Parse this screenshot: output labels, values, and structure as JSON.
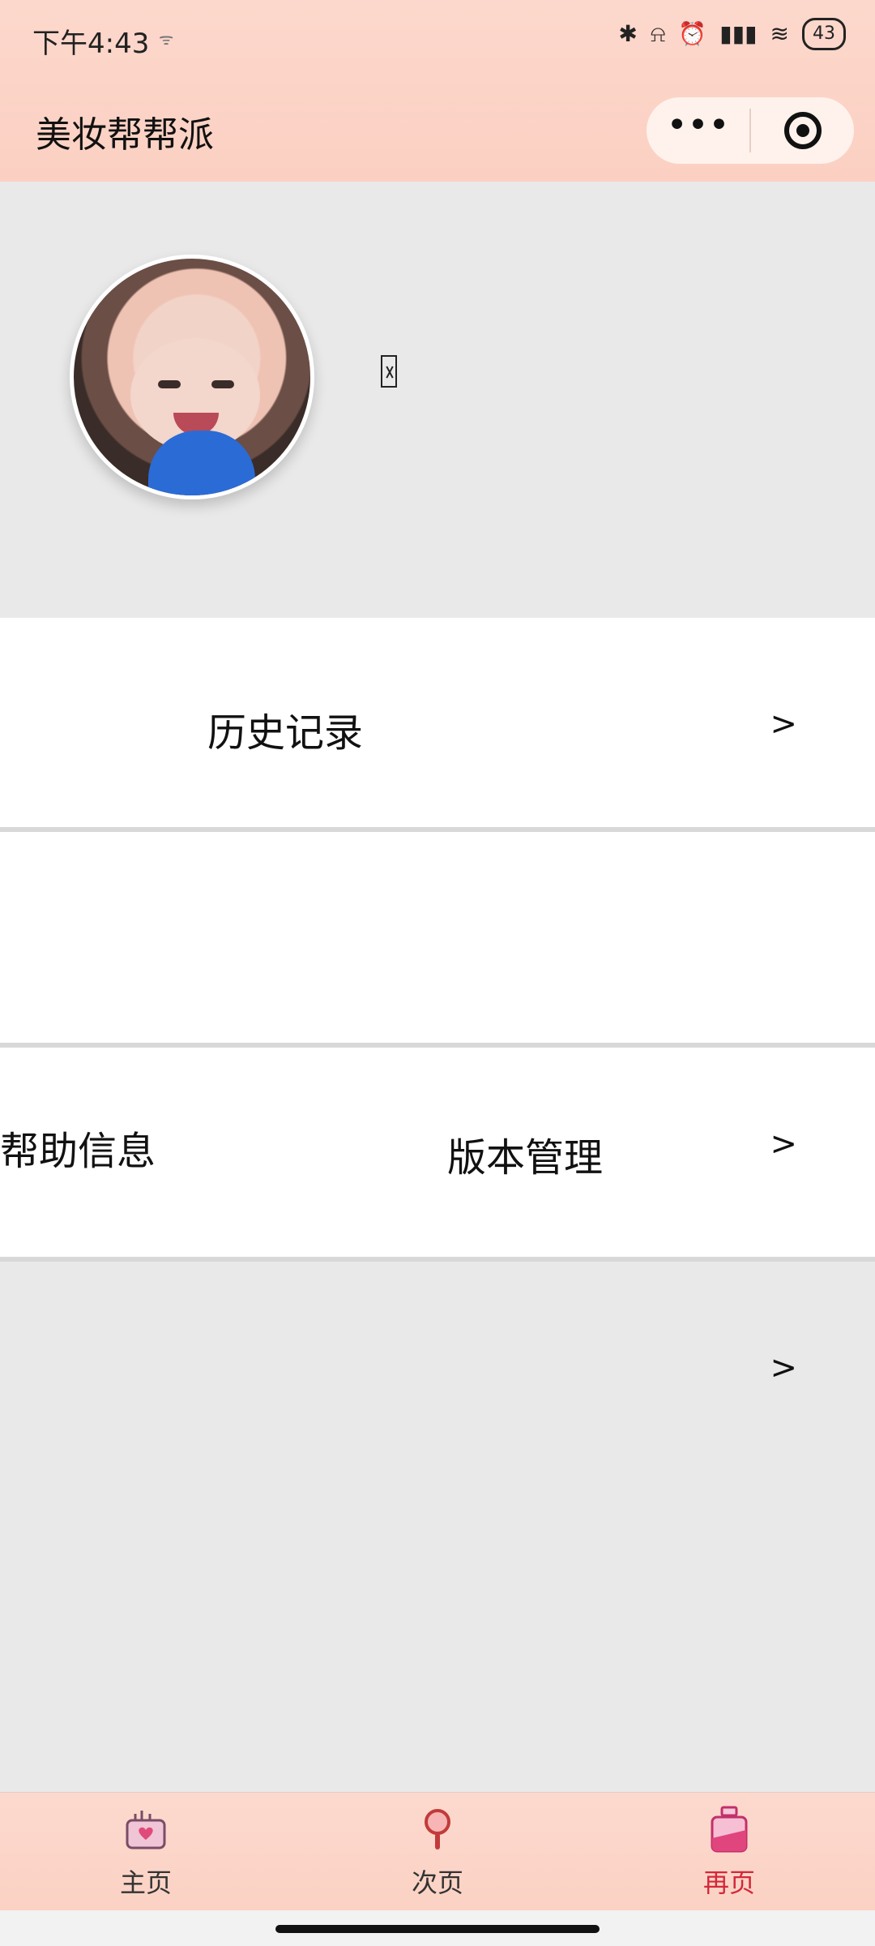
{
  "status_bar": {
    "time": "下午4:43",
    "small_indicator": "ᯤ",
    "battery": "43"
  },
  "nav": {
    "title": "美妆帮帮派",
    "more_label": "•••"
  },
  "profile": {
    "placeholder_glyph": ""
  },
  "rows": {
    "history_label": "历史记录",
    "help_label": "帮助信息",
    "version_label": "版本管理",
    "arrow": ">"
  },
  "tabbar": {
    "items": [
      {
        "label": "主页"
      },
      {
        "label": "次页"
      },
      {
        "label": "再页"
      }
    ],
    "active_color": "#d3283a"
  }
}
